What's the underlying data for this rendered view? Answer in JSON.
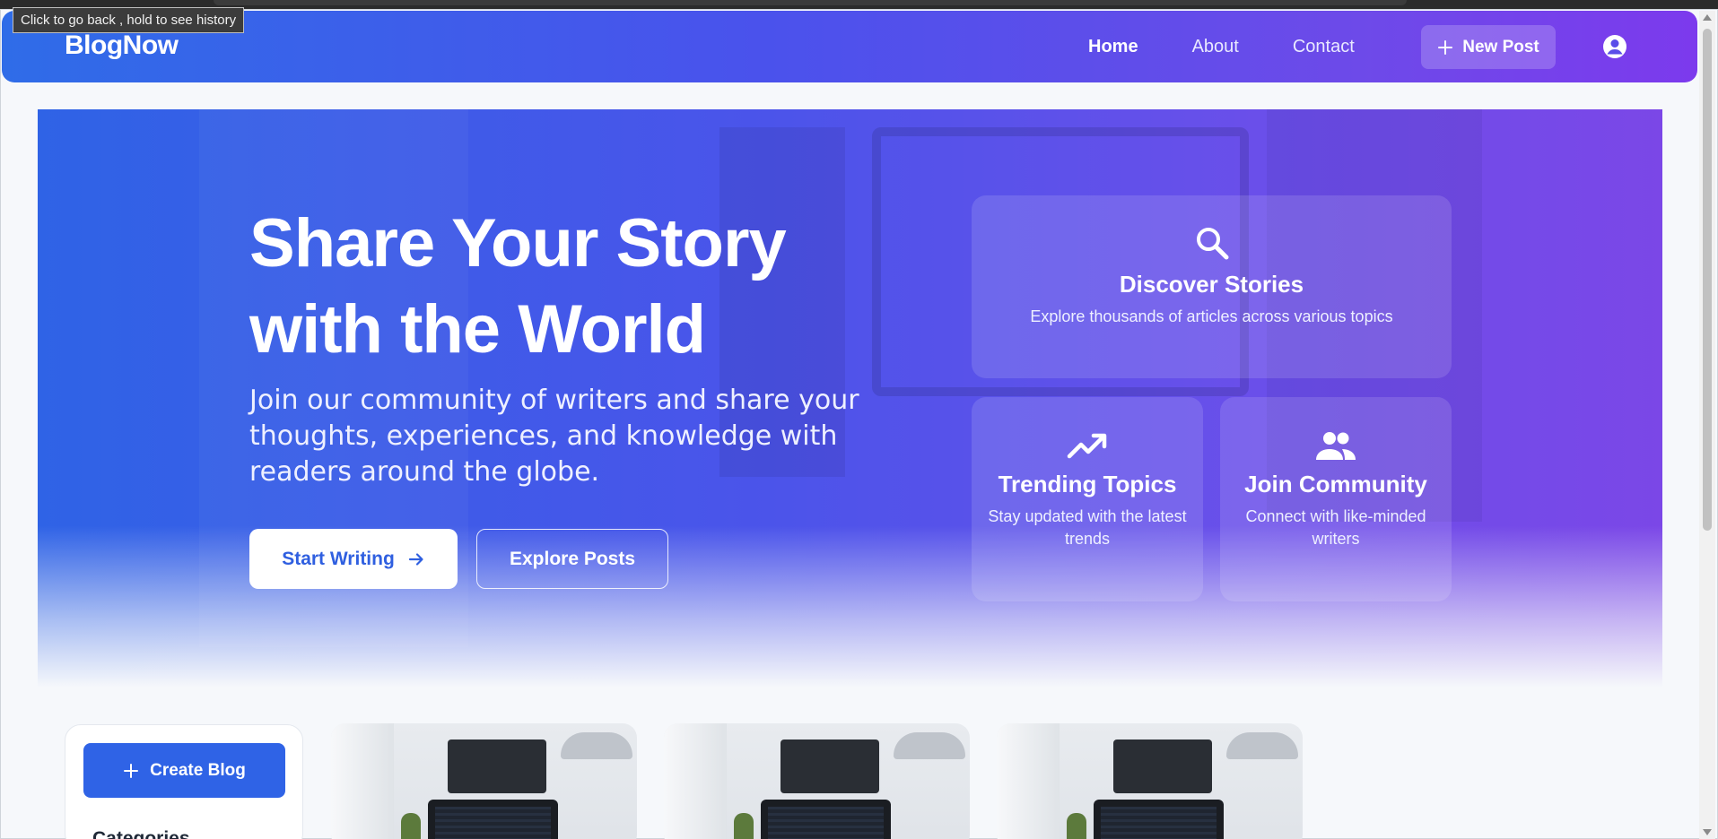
{
  "tooltip": "Click to go back , hold to see history",
  "navbar": {
    "brand": "BlogNow",
    "links": [
      {
        "label": "Home",
        "active": true
      },
      {
        "label": "About",
        "active": false
      },
      {
        "label": "Contact",
        "active": false
      }
    ],
    "new_post_label": "New Post",
    "new_post_icon": "plus-icon",
    "account_icon": "account-circle-icon"
  },
  "hero": {
    "title_line1": "Share Your Story",
    "title_line2": "with the World",
    "subtitle": "Join our community of writers and share your thoughts, experiences, and knowledge with readers around the globe.",
    "start_writing_label": "Start Writing",
    "start_writing_icon": "arrow-right-icon",
    "explore_label": "Explore Posts"
  },
  "features": [
    {
      "icon": "search-icon",
      "title": "Discover Stories",
      "description": "Explore thousands of articles across various topics"
    },
    {
      "icon": "trending-up-icon",
      "title": "Trending Topics",
      "description": "Stay updated with the latest trends"
    },
    {
      "icon": "people-icon",
      "title": "Join Community",
      "description": "Connect with like-minded writers"
    }
  ],
  "sidebar": {
    "create_blog_label": "Create Blog",
    "create_blog_icon": "plus-icon",
    "categories_heading": "Categories"
  },
  "colors": {
    "primary": "#2f63e6",
    "accent_purple": "#7c3aed",
    "background": "#f6f8fb"
  }
}
